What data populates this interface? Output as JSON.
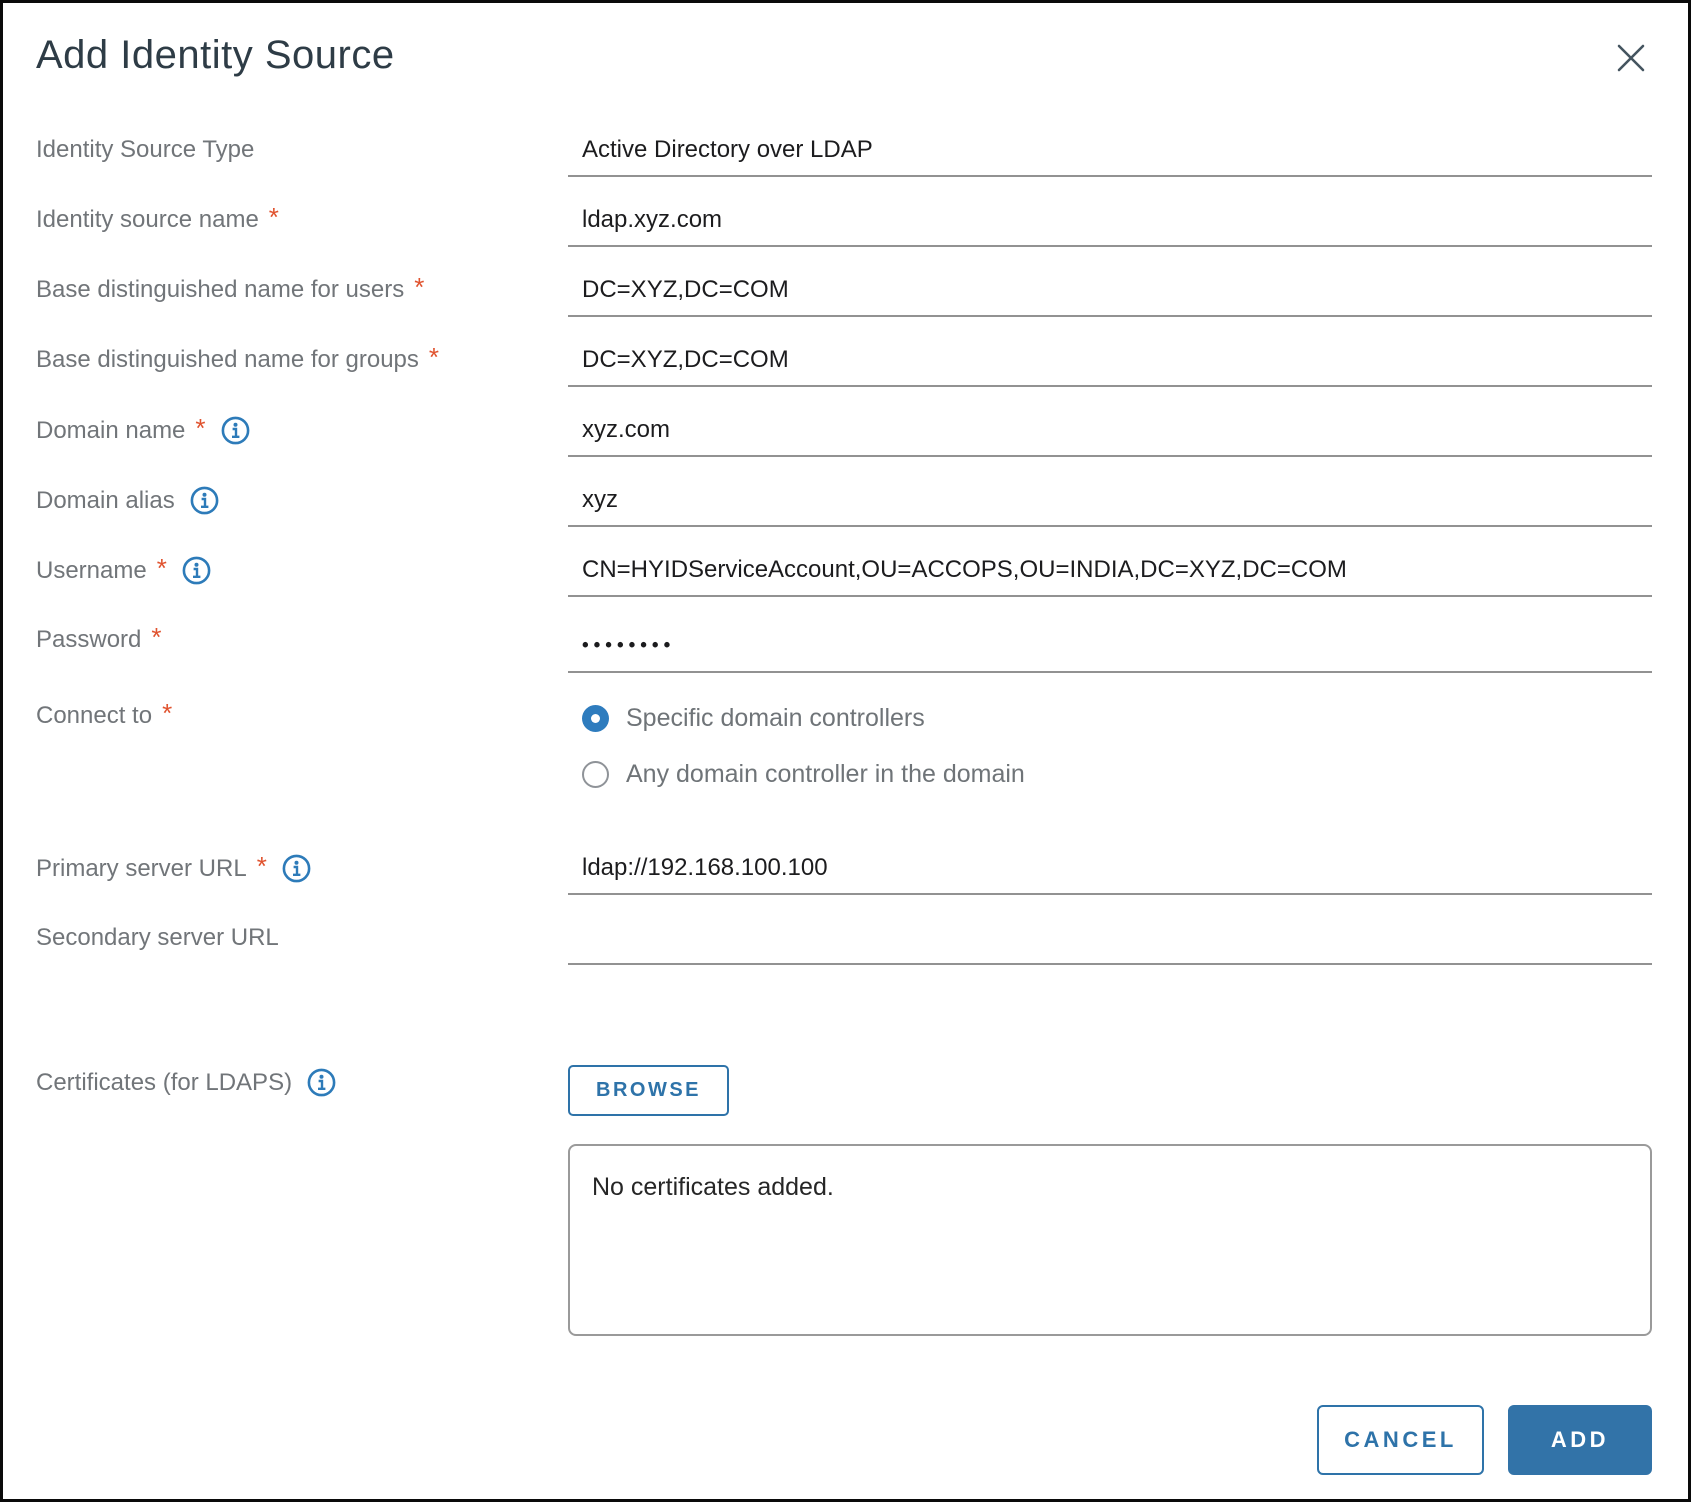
{
  "dialog": {
    "title": "Add Identity Source"
  },
  "required_marker": "*",
  "fields": {
    "identity_source_type": {
      "label": "Identity Source Type",
      "value": "Active Directory over LDAP",
      "required": false
    },
    "identity_source_name": {
      "label": "Identity source name",
      "value": "ldap.xyz.com",
      "required": true
    },
    "base_dn_users": {
      "label": "Base distinguished name for users",
      "value": "DC=XYZ,DC=COM",
      "required": true
    },
    "base_dn_groups": {
      "label": "Base distinguished name for groups",
      "value": "DC=XYZ,DC=COM",
      "required": true
    },
    "domain_name": {
      "label": "Domain name",
      "value": "xyz.com",
      "required": true,
      "has_info": true
    },
    "domain_alias": {
      "label": "Domain alias",
      "value": "xyz",
      "required": false,
      "has_info": true
    },
    "username": {
      "label": "Username",
      "value": "CN=HYIDServiceAccount,OU=ACCOPS,OU=INDIA,DC=XYZ,DC=COM",
      "required": true,
      "has_info": true
    },
    "password": {
      "label": "Password",
      "value": "••••••••",
      "required": true
    },
    "connect_to": {
      "label": "Connect to",
      "required": true,
      "options": [
        {
          "label": "Specific domain controllers",
          "selected": true
        },
        {
          "label": "Any domain controller in the domain",
          "selected": false
        }
      ]
    },
    "primary_server_url": {
      "label": "Primary server URL",
      "value": "ldap://192.168.100.100",
      "required": true,
      "has_info": true
    },
    "secondary_server_url": {
      "label": "Secondary server URL",
      "value": "",
      "required": false
    },
    "certificates": {
      "label": "Certificates (for LDAPS)",
      "has_info": true,
      "browse_label": "BROWSE",
      "empty_text": "No certificates added."
    }
  },
  "footer": {
    "cancel_label": "CANCEL",
    "add_label": "ADD"
  },
  "icons": {
    "close": "close-icon",
    "info": "info-icon"
  },
  "colors": {
    "accent_blue": "#2E73A9",
    "icon_blue": "#2D7BB9",
    "radio_blue": "#2E7CBE",
    "required_orange": "#E0532F",
    "label_gray": "#717579",
    "title_slate": "#2E3C46",
    "underline_gray": "#929292"
  }
}
